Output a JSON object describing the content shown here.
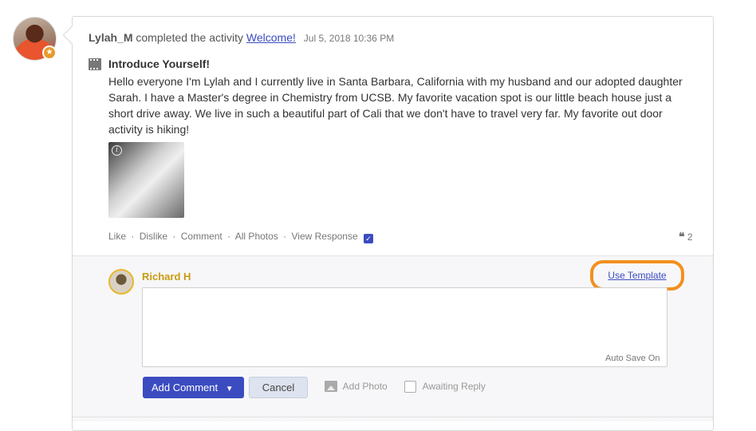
{
  "post": {
    "username": "Lylah_M",
    "action_text": "completed the activity",
    "activity_link": "Welcome!",
    "timestamp": "Jul 5, 2018 10:36 PM",
    "title": "Introduce Yourself!",
    "body": "Hello everyone I'm Lylah and I currently live in Santa Barbara, California with my husband and our adopted daughter Sarah. I have a Master's degree in Chemistry from UCSB. My favorite vacation spot is our little beach house just a short drive away. We live in such a beautiful part of Cali that we don't have to travel very far. My favorite out door activity is hiking!",
    "info_glyph": "i"
  },
  "actions": {
    "like": "Like",
    "dislike": "Dislike",
    "comment": "Comment",
    "all_photos": "All Photos",
    "view_response": "View Response",
    "separator": "·",
    "quote_glyph": "❝",
    "quote_count": "2"
  },
  "comment_form": {
    "commenter": "Richard H",
    "use_template": "Use Template",
    "auto_save": "Auto Save On",
    "add_comment": "Add Comment",
    "cancel": "Cancel",
    "add_photo": "Add Photo",
    "awaiting_reply": "Awaiting Reply"
  },
  "colors": {
    "accent": "#3b4cc0",
    "highlight": "#f3901e",
    "commenter_name": "#c89b12",
    "badge": "#e89a2c"
  },
  "icons": {
    "badge": "star-icon",
    "activity": "film-icon",
    "view_response": "checkbox-checked-icon",
    "quote": "quote-icon",
    "add_comment": "chevron-down-icon",
    "add_photo": "photo-icon"
  }
}
